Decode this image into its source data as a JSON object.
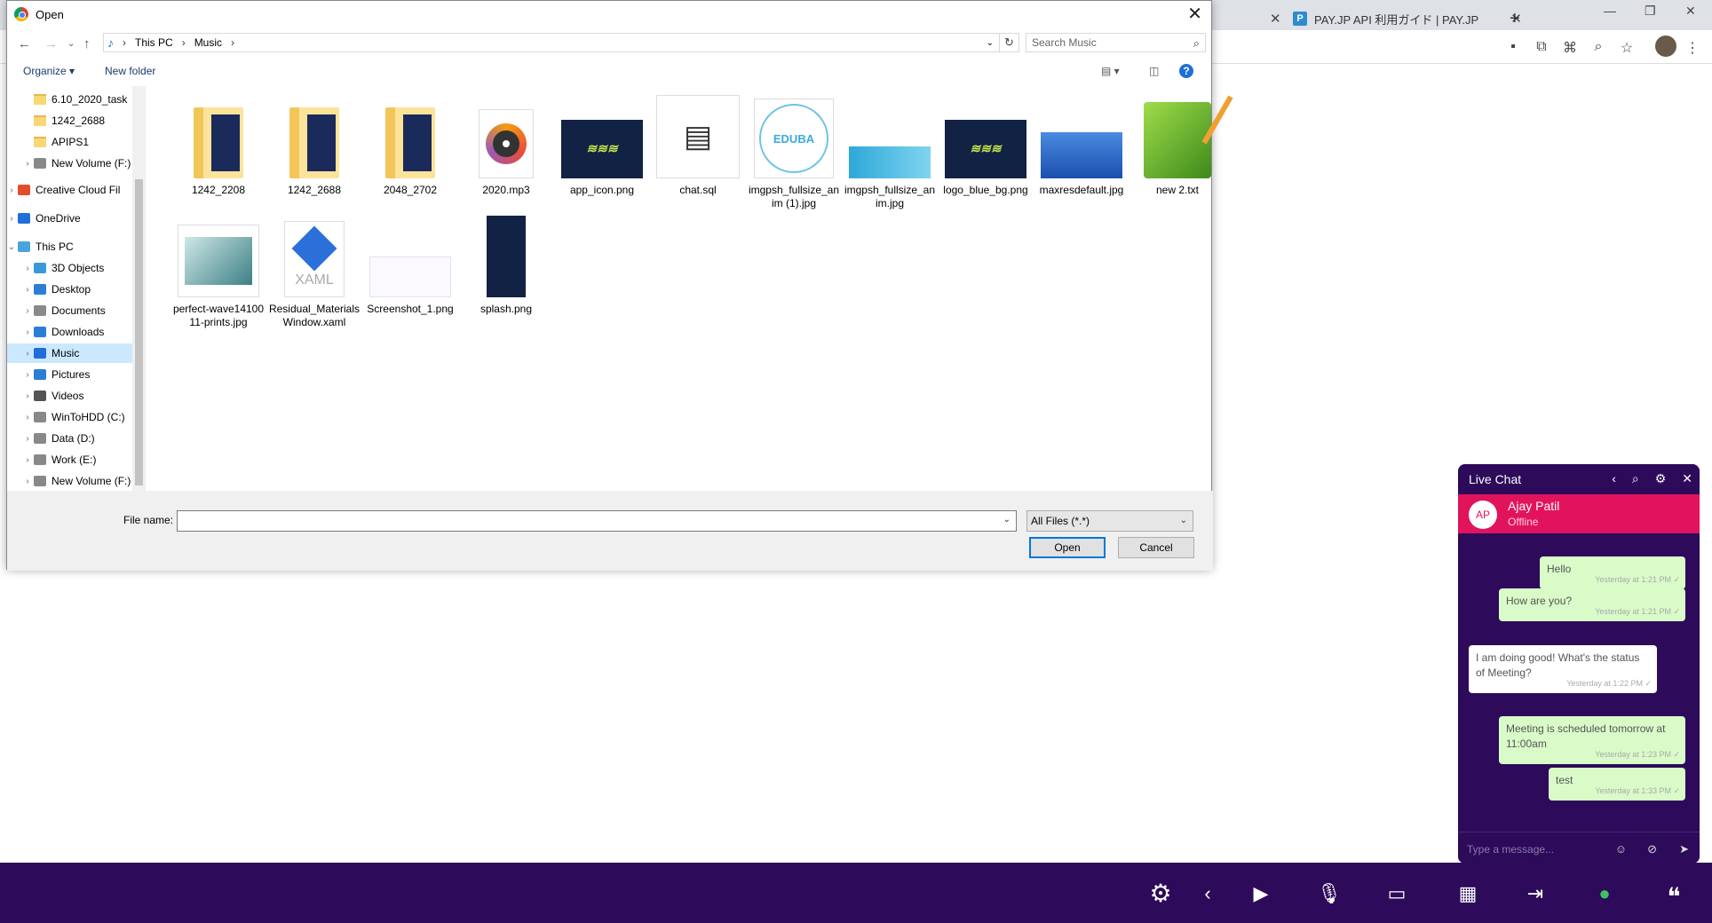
{
  "browser": {
    "tabs": [
      {
        "label": ""
      },
      {
        "label": "PAY.JP API 利用ガイド | PAY.JP"
      }
    ],
    "new_tab": "+",
    "window_buttons": [
      "—",
      "❐",
      "✕"
    ]
  },
  "dialog": {
    "title": "Open",
    "breadcrumb": [
      "This PC",
      "Music"
    ],
    "search_placeholder": "Search Music",
    "organize": "Organize ▾",
    "new_folder": "New folder",
    "nav": [
      {
        "label": "6.10_2020_task",
        "type": "folder",
        "indent": 1
      },
      {
        "label": "1242_2688",
        "type": "folder",
        "indent": 1
      },
      {
        "label": "APIPS1",
        "type": "folder",
        "indent": 1
      },
      {
        "label": "New Volume (F:)",
        "type": "drive",
        "indent": 1
      },
      {
        "label": "Creative Cloud Fil",
        "type": "cc",
        "indent": 0
      },
      {
        "label": "OneDrive",
        "type": "cloud",
        "indent": 0
      },
      {
        "label": "This PC",
        "type": "pc",
        "indent": 0
      },
      {
        "label": "3D Objects",
        "type": "obj",
        "indent": 1
      },
      {
        "label": "Desktop",
        "type": "desk",
        "indent": 1
      },
      {
        "label": "Documents",
        "type": "doc",
        "indent": 1
      },
      {
        "label": "Downloads",
        "type": "dl",
        "indent": 1
      },
      {
        "label": "Music",
        "type": "music",
        "indent": 1
      },
      {
        "label": "Pictures",
        "type": "pic",
        "indent": 1
      },
      {
        "label": "Videos",
        "type": "vid",
        "indent": 1
      },
      {
        "label": "WinToHDD (C:)",
        "type": "drive",
        "indent": 1
      },
      {
        "label": "Data (D:)",
        "type": "drive",
        "indent": 1
      },
      {
        "label": "Work (E:)",
        "type": "drive",
        "indent": 1
      },
      {
        "label": "New Volume (F:)",
        "type": "drive",
        "indent": 1
      }
    ],
    "files": [
      {
        "name": "1242_2208",
        "kind": "folder"
      },
      {
        "name": "1242_2688",
        "kind": "folder"
      },
      {
        "name": "2048_2702",
        "kind": "folder"
      },
      {
        "name": "2020.mp3",
        "kind": "mp3"
      },
      {
        "name": "app_icon.png",
        "kind": "school"
      },
      {
        "name": "chat.sql",
        "kind": "sql"
      },
      {
        "name": "imgpsh_fullsize_anim (1).jpg",
        "kind": "eduba"
      },
      {
        "name": "imgpsh_fullsize_anim.jpg",
        "kind": "bluestrip"
      },
      {
        "name": "logo_blue_bg.png",
        "kind": "school"
      },
      {
        "name": "maxresdefault.jpg",
        "kind": "wave"
      },
      {
        "name": "new 2.txt",
        "kind": "notepad"
      },
      {
        "name": "perfect-wave1410011-prints.jpg",
        "kind": "photo"
      },
      {
        "name": "Residual_MaterialsWindow.xaml",
        "kind": "xaml"
      },
      {
        "name": "Screenshot_1.png",
        "kind": "screenshot"
      },
      {
        "name": "splash.png",
        "kind": "splash"
      }
    ],
    "eduba_text": "EDUBA",
    "xaml_text": "XAML",
    "file_name_label": "File name:",
    "file_name_value": "",
    "file_type": "All Files (*.*)",
    "open_button": "Open",
    "cancel_button": "Cancel"
  },
  "chat": {
    "title": "Live Chat",
    "avatar": "AP",
    "contact_name": "Ajay Patil",
    "contact_status": "Offline",
    "messages": [
      {
        "text": "Hello",
        "time": "Yesterday at 1:21 PM",
        "dir": "out"
      },
      {
        "text": "How are you?",
        "time": "Yesterday at 1:21 PM",
        "dir": "out"
      },
      {
        "text": "I am doing good! What's the status of Meeting?",
        "time": "Yesterday at 1:22 PM",
        "dir": "in"
      },
      {
        "text": "Meeting is scheduled tomorrow at 11:00am",
        "time": "Yesterday at 1:23 PM",
        "dir": "out"
      },
      {
        "text": "test",
        "time": "Yesterday at 1:33 PM",
        "dir": "out"
      }
    ],
    "input_placeholder": "Type a message..."
  },
  "colors": {
    "bar": "#2d0a5a",
    "chat_contact": "#e2135d",
    "bubble_out": "#d8fbc8",
    "accent": "#0078d7"
  }
}
